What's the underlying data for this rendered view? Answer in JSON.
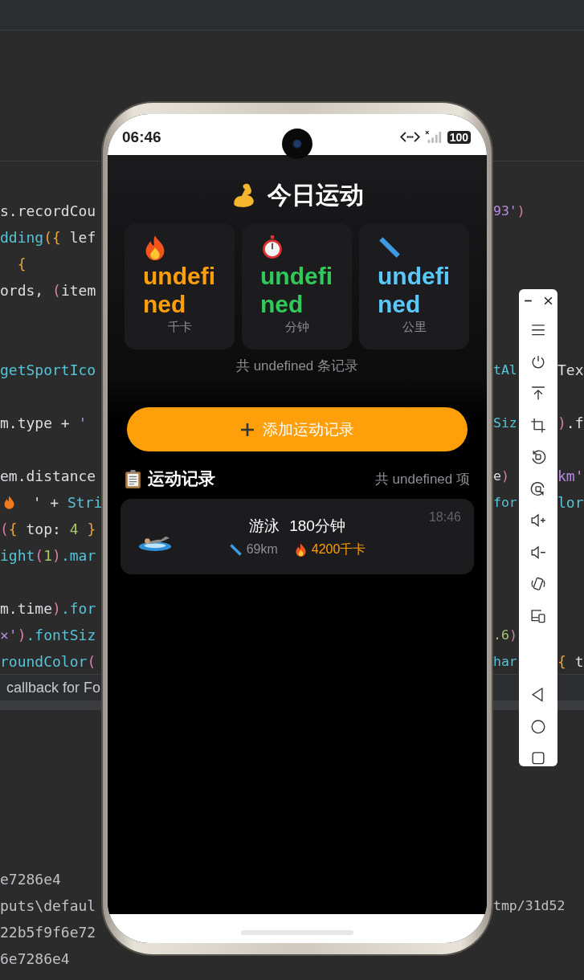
{
  "ide": {
    "editor_lines": [
      {
        "kind": "code",
        "left": [
          {
            "text": "s.recordCou",
            "kind": "text"
          }
        ],
        "right": [
          {
            "text": "93'",
            "kind": "str"
          },
          {
            "text": ")",
            "kind": "paren"
          }
        ]
      },
      {
        "kind": "code",
        "left": [
          {
            "text": "dding",
            "kind": "call"
          },
          {
            "text": "({",
            "kind": "brace"
          },
          {
            "text": " lef",
            "kind": "text"
          }
        ]
      },
      {
        "kind": "code",
        "left": [
          {
            "text": "  {",
            "kind": "brace"
          }
        ]
      },
      {
        "kind": "code",
        "left": [
          {
            "text": "ords, ",
            "kind": "text"
          },
          {
            "text": "(",
            "kind": "paren"
          },
          {
            "text": "item",
            "kind": "text"
          }
        ]
      },
      {
        "kind": "blank"
      },
      {
        "kind": "blank"
      },
      {
        "kind": "code",
        "left": [
          {
            "text": "getSportIco",
            "kind": "call"
          }
        ],
        "right": [
          {
            "text": "tAl",
            "kind": "call"
          }
        ],
        "far": [
          {
            "text": "Tex",
            "kind": "text"
          }
        ]
      },
      {
        "kind": "blank"
      },
      {
        "kind": "code",
        "left": [
          {
            "text": "m.type + ",
            "kind": "text"
          },
          {
            "text": "'",
            "kind": "str"
          }
        ],
        "right": [
          {
            "text": "Siz",
            "kind": "call"
          }
        ],
        "far": [
          {
            "text": ")",
            "kind": "paren"
          },
          {
            "text": ".f",
            "kind": "text"
          }
        ]
      },
      {
        "kind": "blank"
      },
      {
        "kind": "code",
        "left": [
          {
            "text": "em.distance",
            "kind": "text"
          }
        ],
        "right": [
          {
            "text": "e",
            "kind": "text"
          },
          {
            "text": ")",
            "kind": "paren"
          }
        ],
        "far": [
          {
            "text": "km'",
            "kind": "str"
          }
        ]
      },
      {
        "kind": "code",
        "left": [
          {
            "kind": "fire"
          },
          {
            "text": "  ' + ",
            "kind": "text"
          },
          {
            "text": "Stri",
            "kind": "call"
          }
        ],
        "right": [
          {
            "text": "for",
            "kind": "call"
          }
        ],
        "far": [
          {
            "text": "lor",
            "kind": "call"
          }
        ]
      },
      {
        "kind": "code",
        "left": [
          {
            "text": "(",
            "kind": "paren"
          },
          {
            "text": "{",
            "kind": "brace"
          },
          {
            "text": " top: ",
            "kind": "text"
          },
          {
            "text": "4",
            "kind": "num"
          },
          {
            "text": " }",
            "kind": "brace"
          }
        ]
      },
      {
        "kind": "code",
        "left": [
          {
            "text": "ight",
            "kind": "call"
          },
          {
            "text": "(",
            "kind": "paren"
          },
          {
            "text": "1",
            "kind": "num"
          },
          {
            "text": ")",
            "kind": "paren"
          },
          {
            "text": ".mar",
            "kind": "call"
          }
        ]
      },
      {
        "kind": "blank"
      },
      {
        "kind": "code",
        "left": [
          {
            "text": "m.time",
            "kind": "text"
          },
          {
            "text": ")",
            "kind": "paren"
          },
          {
            "text": ".for",
            "kind": "call"
          }
        ]
      },
      {
        "kind": "code",
        "left": [
          {
            "text": "×'",
            "kind": "str"
          },
          {
            "text": ")",
            "kind": "paren"
          },
          {
            "text": ".fontSiz",
            "kind": "call"
          }
        ],
        "right": [
          {
            "text": ".6",
            "kind": "num"
          },
          {
            "text": ")",
            "kind": "paren"
          }
        ]
      },
      {
        "kind": "code",
        "left": [
          {
            "text": "roundColor",
            "kind": "call"
          },
          {
            "text": "(",
            "kind": "paren"
          }
        ],
        "right": [
          {
            "text": "har",
            "kind": "call"
          }
        ],
        "far": [
          {
            "text": "{",
            "kind": "brace"
          },
          {
            "text": " t",
            "kind": "text"
          }
        ]
      }
    ],
    "status_text": "callback for Fo",
    "console_lines": [
      {
        "left": "e7286e4"
      },
      {
        "left": "puts\\defaul",
        "right": "tmp/31d52"
      },
      {
        "left": "22b5f9f6e72"
      },
      {
        "left": "6e7286e4"
      }
    ]
  },
  "phone": {
    "status_bar": {
      "time": "06:46",
      "battery": "100"
    },
    "title": "今日运动",
    "stats": [
      {
        "kind": "calories",
        "value": "undefined",
        "unit": "千卡"
      },
      {
        "kind": "duration",
        "value": "undefined",
        "unit": "分钟"
      },
      {
        "kind": "distance",
        "value": "undefined",
        "unit": "公里"
      }
    ],
    "record_summary": "共 undefined 条记录",
    "add_button": "添加运动记录",
    "section": {
      "title": "运动记录",
      "count": "共 undefined 项"
    },
    "records": [
      {
        "kind": "swimming",
        "type": "游泳",
        "duration": "180分钟",
        "distance": "69km",
        "calories": "4200千卡",
        "time": "18:46"
      }
    ]
  }
}
